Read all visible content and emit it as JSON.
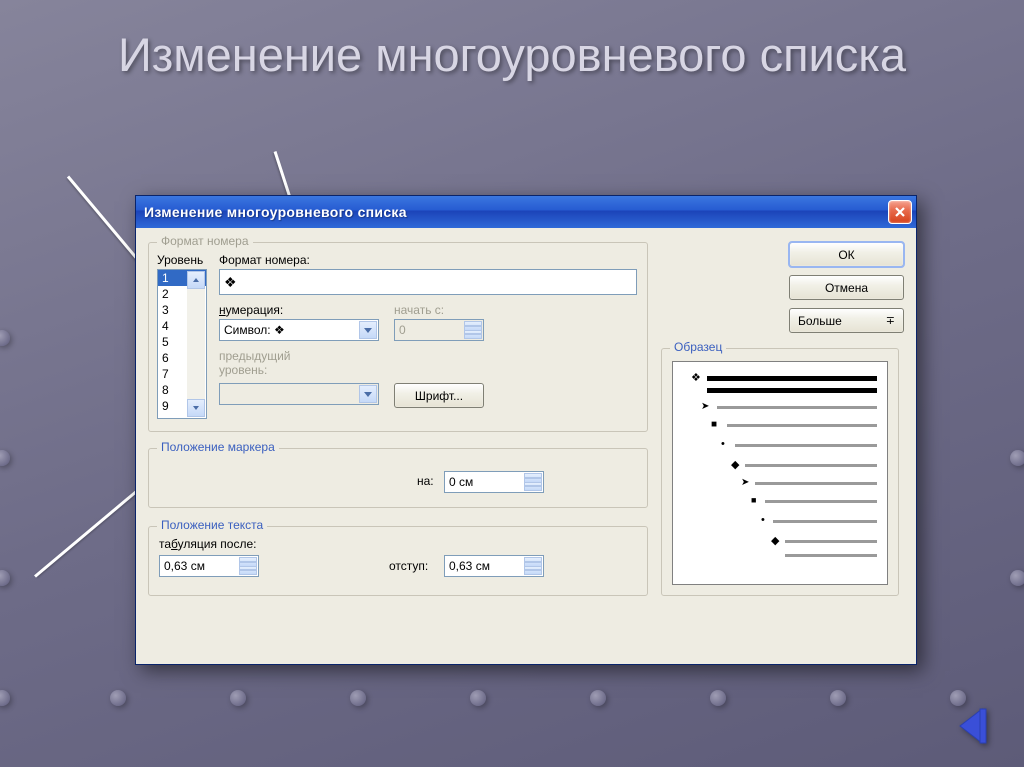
{
  "slide": {
    "title": "Изменение многоуровневого списка"
  },
  "dialog": {
    "title": "Изменение многоуровневого списка",
    "groups": {
      "number_format": "Формат номера",
      "marker_position": "Положение маркера",
      "text_position": "Положение текста",
      "sample": "Образец"
    },
    "labels": {
      "level": "Уровень",
      "number_format": "Формат номера:",
      "numbering": "нумерация:",
      "numbering_u": "н",
      "start_at": "начать с:",
      "previous_level": "предыдущий уровень:",
      "font_button": "Шрифт...",
      "marker_at": "на:",
      "tab_after": "табуляция после:",
      "tab_after_u": "б",
      "indent": "отступ:"
    },
    "values": {
      "levels": [
        "1",
        "2",
        "3",
        "4",
        "5",
        "6",
        "7",
        "8",
        "9"
      ],
      "selected_level": "1",
      "number_format_field": "❖",
      "numbering_select": "Символ: ❖",
      "start_at": "0",
      "previous_level": "",
      "marker_at": "0 см",
      "tab_after": "0,63 см",
      "indent": "0,63 см"
    },
    "buttons": {
      "ok": "ОК",
      "cancel": "Отмена",
      "more": "Больше",
      "font": "Шрифт..."
    }
  }
}
